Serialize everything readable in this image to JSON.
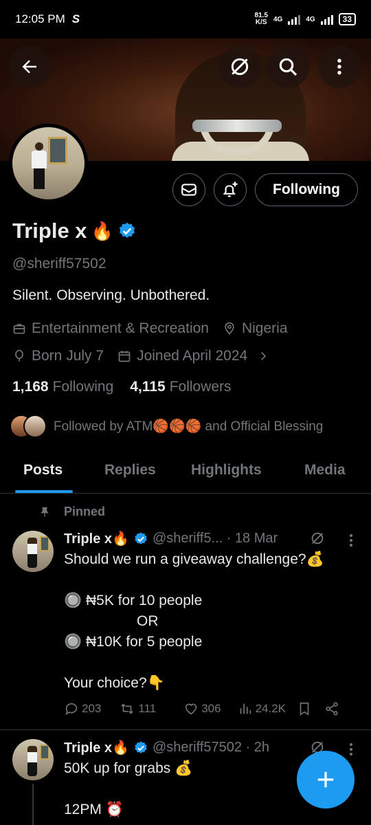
{
  "status": {
    "time": "12:05 PM",
    "app_glyph": "S",
    "net_speed_value": "81.5",
    "net_speed_unit": "K/S",
    "sim1": "4G",
    "sim2": "4G",
    "battery": "33"
  },
  "profile": {
    "name": "Triple x",
    "name_emoji": "🔥",
    "handle": "@sheriff57502",
    "bio": "Silent. Observing. Unbothered.",
    "category": "Entertainment & Recreation",
    "location": "Nigeria",
    "born": "Born July 7",
    "joined": "Joined April 2024",
    "following_count": "1,168",
    "following_label": "Following",
    "followers_count": "4,115",
    "followers_label": "Followers",
    "followed_by": "Followed by ATM🏀🏀🏀 and Official Blessing"
  },
  "buttons": {
    "following": "Following"
  },
  "tabs": [
    {
      "label": "Posts"
    },
    {
      "label": "Replies"
    },
    {
      "label": "Highlights"
    },
    {
      "label": "Media"
    }
  ],
  "posts": [
    {
      "pinned_label": "Pinned",
      "author": "Triple x🔥",
      "handle_time": "@sheriff5... · 18 Mar",
      "lines": [
        "Should we run a giveaway challenge?💰",
        "",
        "🔘 ₦5K for 10 people",
        "OR",
        "🔘 ₦10K for 5 people",
        "",
        "Your choice?👇"
      ],
      "replies": "203",
      "reposts": "111",
      "likes": "306",
      "views": "24.2K"
    },
    {
      "author": "Triple x🔥",
      "handle_time": "@sheriff57502 · 2h",
      "lines": [
        "50K up for grabs 💰",
        "",
        "12PM ⏰"
      ]
    }
  ],
  "colors": {
    "accent": "#1d9bf0",
    "muted": "#71767b",
    "text": "#e7e9ea",
    "verified": "#1d9bf0"
  }
}
